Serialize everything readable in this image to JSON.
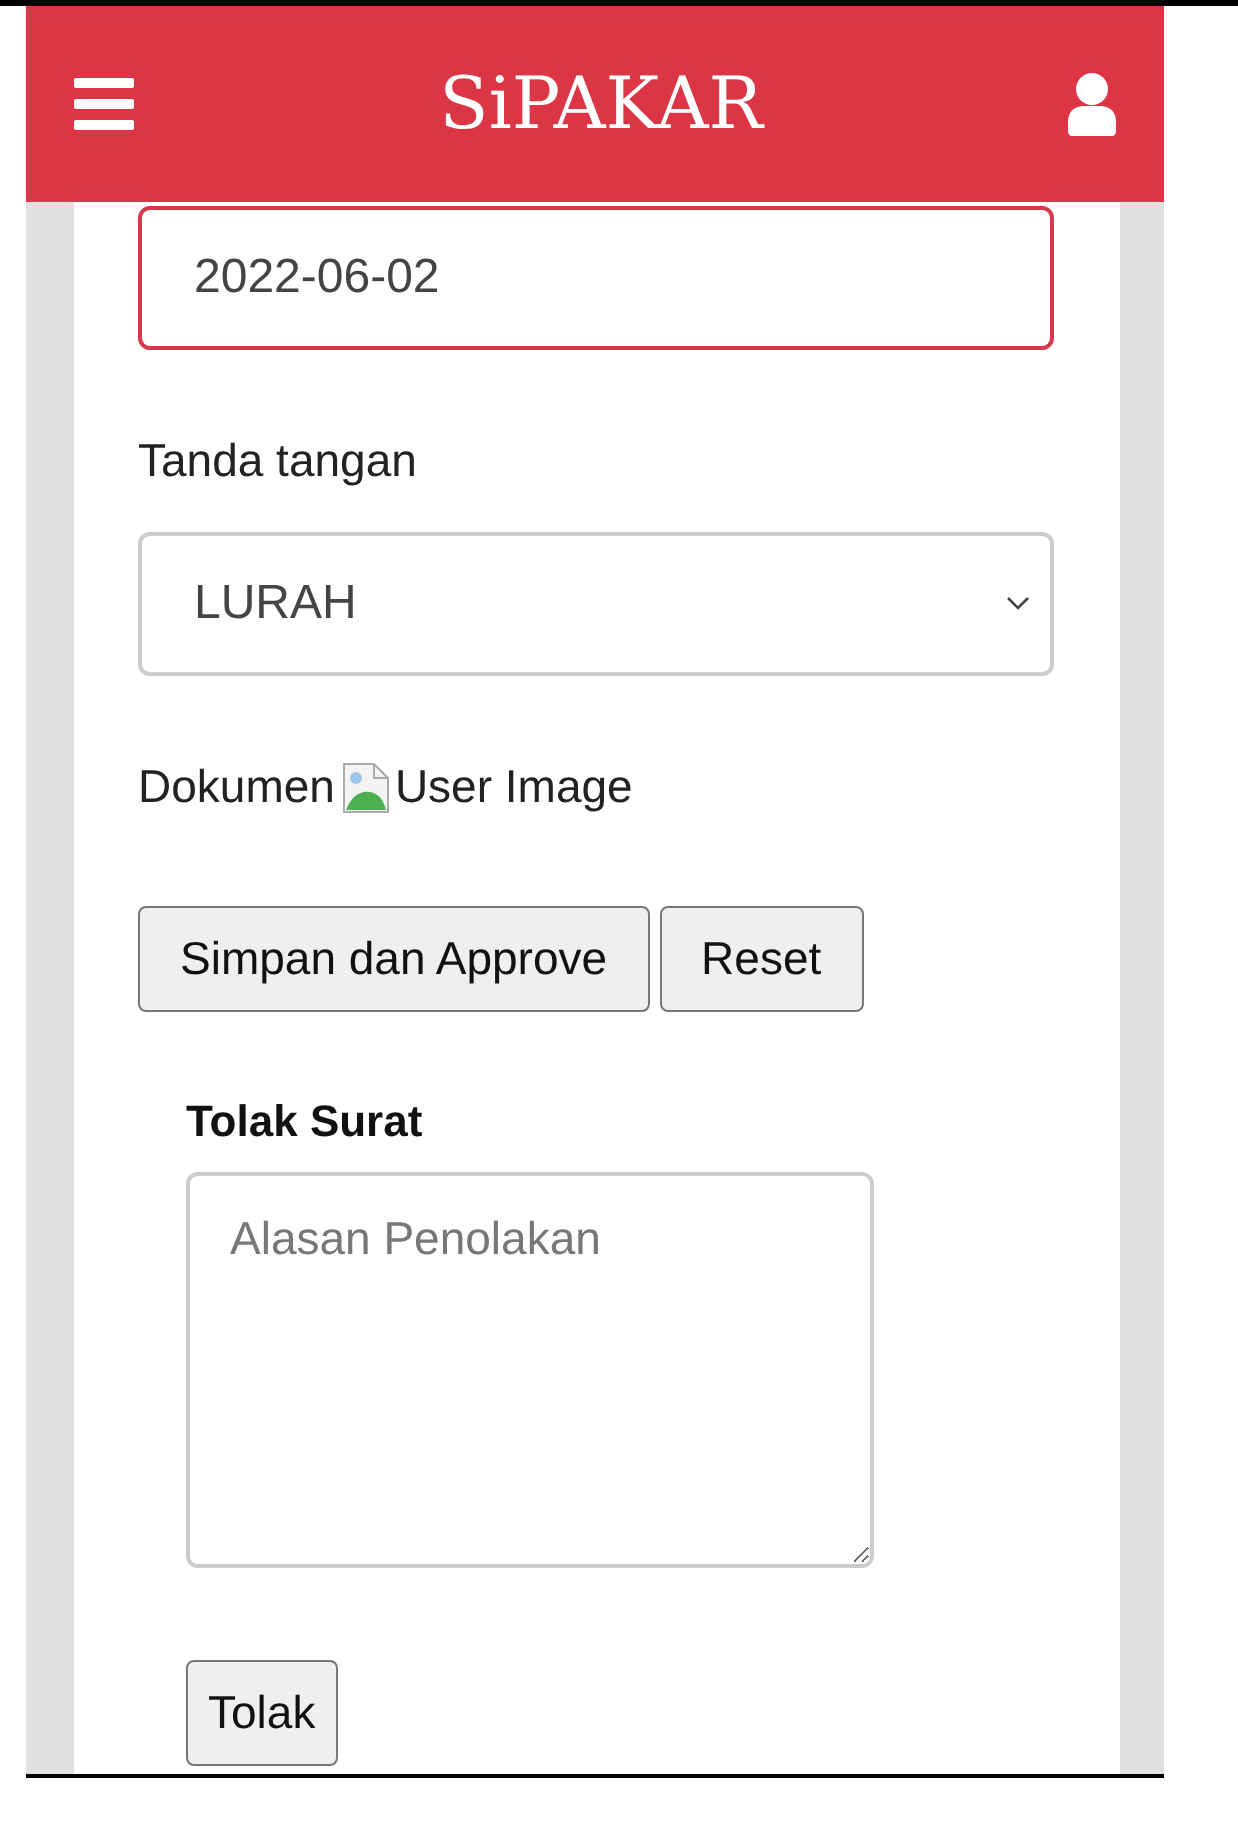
{
  "header": {
    "title": "SiPAKAR"
  },
  "form": {
    "date_field": {
      "value": "2022-06-02",
      "focused": true
    },
    "signature": {
      "label": "Tanda tangan",
      "value": "LURAH"
    },
    "document": {
      "label": "Dokumen",
      "image_alt": "User Image"
    },
    "buttons": [
      "Simpan dan Approve",
      "Reset"
    ]
  },
  "reject": {
    "title": "Tolak Surat",
    "placeholder": "Alasan Penolakan",
    "button": "Tolak"
  }
}
